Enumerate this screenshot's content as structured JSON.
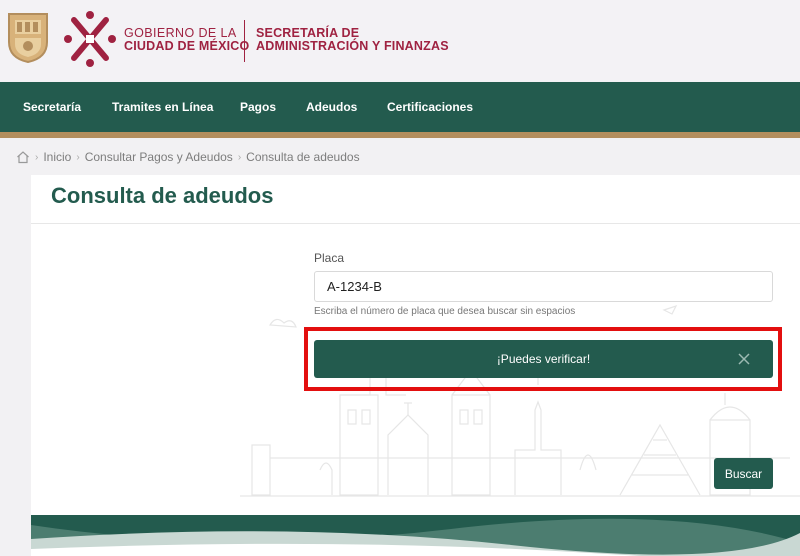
{
  "header": {
    "gov_line1": "GOBIERNO DE LA",
    "gov_line2": "CIUDAD DE MÉXICO",
    "sec_line1": "SECRETARÍA DE",
    "sec_line2": "ADMINISTRACIÓN Y FINANZAS"
  },
  "nav": {
    "items": [
      "Secretaría",
      "Tramites en Línea",
      "Pagos",
      "Adeudos",
      "Certificaciones"
    ]
  },
  "breadcrumb": {
    "home_icon": "home-icon",
    "items": [
      "Inicio",
      "Consultar Pagos y Adeudos",
      "Consulta de adeudos"
    ]
  },
  "page": {
    "title": "Consulta de adeudos"
  },
  "form": {
    "label": "Placa",
    "value": "A-1234-B",
    "hint": "Escriba el número de placa que desea buscar sin espacios"
  },
  "alert": {
    "message": "¡Puedes verificar!",
    "close_icon": "close-icon"
  },
  "actions": {
    "search_label": "Buscar"
  },
  "colors": {
    "primary_green": "#235b4e",
    "brand_maroon": "#9f2241",
    "gold": "#b38e5d",
    "highlight_red": "#e30f0f"
  }
}
